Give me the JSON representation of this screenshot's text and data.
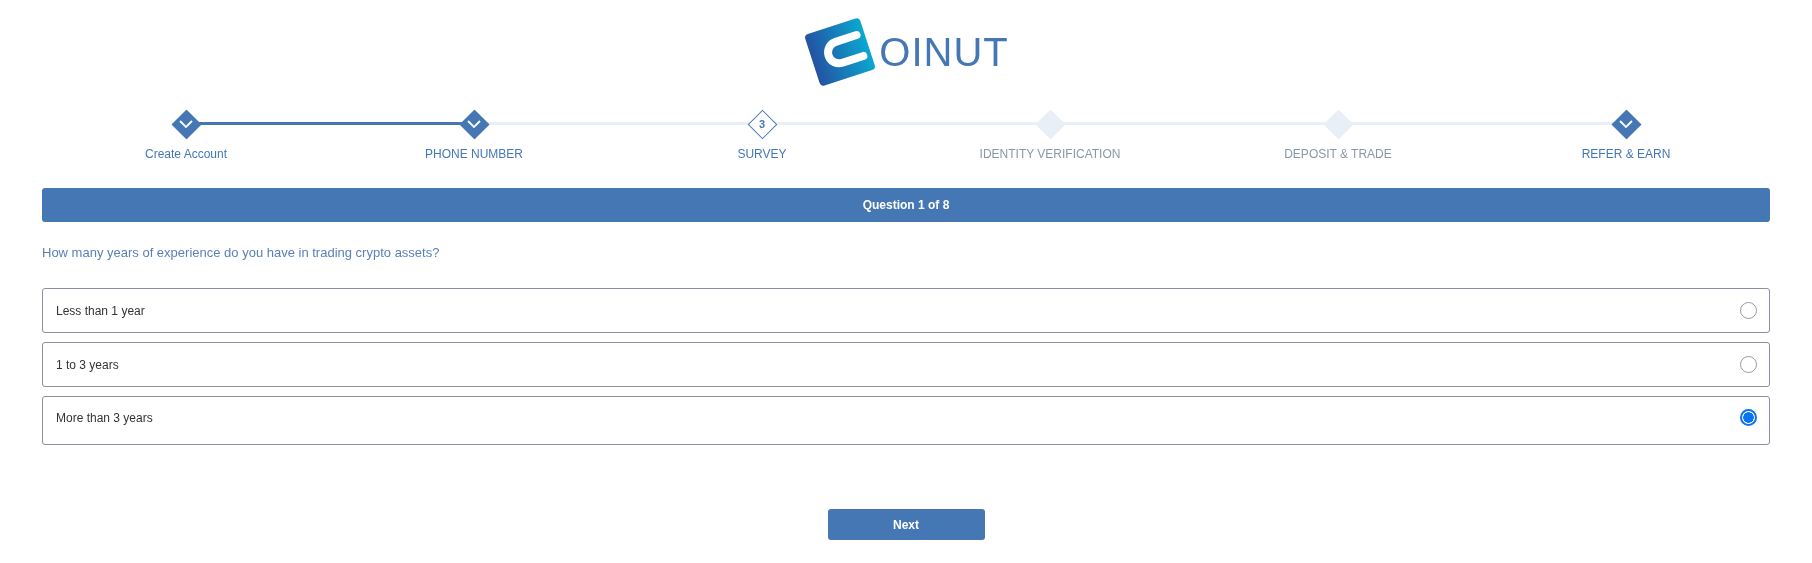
{
  "logo": {
    "text": "OINUT"
  },
  "steps": [
    {
      "label": "Create Account",
      "kind": "done"
    },
    {
      "label": "PHONE NUMBER",
      "kind": "done"
    },
    {
      "label": "SURVEY",
      "kind": "current",
      "number": "3"
    },
    {
      "label": "IDENTITY VERIFICATION",
      "kind": "pending"
    },
    {
      "label": "DEPOSIT & TRADE",
      "kind": "pending"
    },
    {
      "label": "REFER & EARN",
      "kind": "done"
    }
  ],
  "question_header": "Question 1 of 8",
  "question": "How many years of experience do you have in trading crypto assets?",
  "options": [
    {
      "label": "Less than 1 year",
      "selected": false
    },
    {
      "label": "1 to 3 years",
      "selected": false
    },
    {
      "label": "More than 3 years",
      "selected": true
    }
  ],
  "next_button": "Next"
}
